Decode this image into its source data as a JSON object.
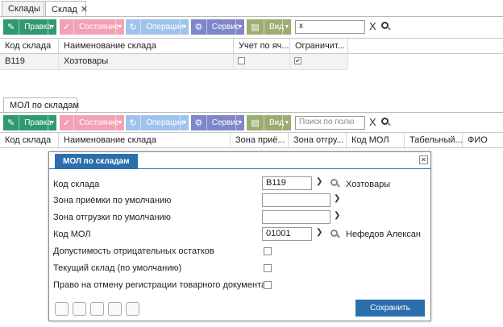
{
  "tabs": [
    {
      "label": "Склады"
    },
    {
      "label": "Склад",
      "close": "✕"
    }
  ],
  "toolbar1": {
    "edit": "Правка",
    "state": "Состояние",
    "operations": "Операции",
    "service": "Сервис",
    "view": "Вид",
    "search_value": "x",
    "clear": "X"
  },
  "grid1": {
    "headers": [
      "Код склада",
      "Наименование склада",
      "Учет по яч...",
      "Ограничит..."
    ],
    "rows": [
      {
        "code": "B119",
        "name": "Хозтовары",
        "cell_accounting": false,
        "limited": true
      }
    ]
  },
  "section_tab": "МОЛ по складам",
  "toolbar2": {
    "edit": "Правка",
    "state": "Состояние",
    "operations": "Операции",
    "service": "Сервис",
    "view": "Вид",
    "search_placeholder": "Поиск по полю",
    "clear": "X"
  },
  "grid2": {
    "headers": [
      "Код склада",
      "Наименование склада",
      "Зона приё...",
      "Зона отгру...",
      "Код МОЛ",
      "Табельный...",
      "ФИО"
    ]
  },
  "dialog": {
    "title": "МОЛ по складам",
    "close": "✕",
    "fields": {
      "warehouse_code_label": "Код склада",
      "warehouse_code_value": "B119",
      "warehouse_name": "Хозтовары",
      "receiving_zone_label": "Зона приёмки по умолчанию",
      "shipping_zone_label": "Зона отгрузки по умолчанию",
      "mol_code_label": "Код МОЛ",
      "mol_code_value": "01001",
      "mol_name": "Нефедов Алексан",
      "negative_balance_label": "Допустимость отрицательных остатков",
      "current_warehouse_label": "Текущий склад (по умолчанию)",
      "cancel_registration_label": "Право на отмену регистрации товарного документа"
    },
    "save_label": "Сохранить"
  },
  "colors": {
    "edit": "#2f9a6f",
    "state": "#f1a2b3",
    "operations": "#9fc3ec",
    "service": "#7f86c9",
    "view": "#9aae70",
    "dialog_accent": "#2c6fad"
  }
}
